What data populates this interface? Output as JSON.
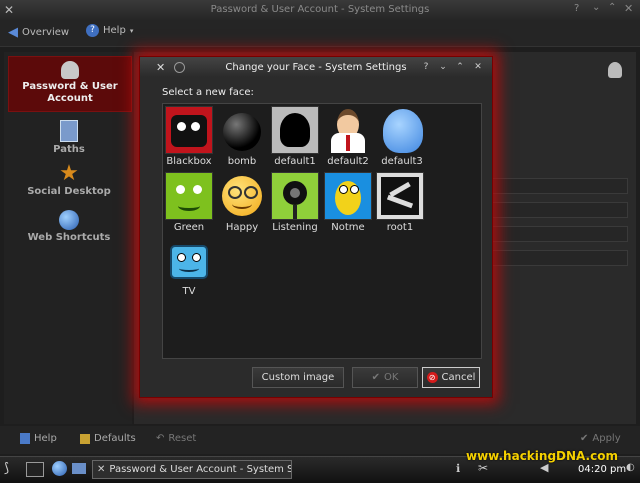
{
  "window": {
    "title": "Password & User Account - System Settings"
  },
  "toolbar": {
    "overview": "Overview",
    "help": "Help"
  },
  "sidebar": {
    "items": [
      {
        "label": "Password & User Account",
        "icon": "user-icon"
      },
      {
        "label": "Paths",
        "icon": "paths-icon"
      },
      {
        "label": "Social Desktop",
        "icon": "star-icon"
      },
      {
        "label": "Web Shortcuts",
        "icon": "globe-icon"
      }
    ]
  },
  "dialog": {
    "title": "Change your Face - System Settings",
    "prompt": "Select a new face:",
    "faces": [
      {
        "label": "Blackbox",
        "color": "#c0141c"
      },
      {
        "label": "bomb",
        "color": "#111111"
      },
      {
        "label": "default1",
        "color": "#bbbbbb"
      },
      {
        "label": "default2",
        "color": "#ffffff"
      },
      {
        "label": "default3",
        "color": "#3f86e0"
      },
      {
        "label": "Green",
        "color": "#7ec11e"
      },
      {
        "label": "Happy",
        "color": "#f2c418"
      },
      {
        "label": "Listening",
        "color": "#8fd03a"
      },
      {
        "label": "Notme",
        "color": "#1a8fe0"
      },
      {
        "label": "root1",
        "color": "#dddddd"
      },
      {
        "label": "TV",
        "color": "#4cb5e8"
      }
    ],
    "buttons": {
      "custom": "Custom image",
      "ok": "OK",
      "cancel": "Cancel"
    }
  },
  "bottombar": {
    "help": "Help",
    "defaults": "Defaults",
    "reset": "Reset",
    "apply": "Apply"
  },
  "taskbar": {
    "task": "Password & User Account - System Se",
    "watermark": "www.hackingDNA.com",
    "clock": "04:20 pm"
  }
}
